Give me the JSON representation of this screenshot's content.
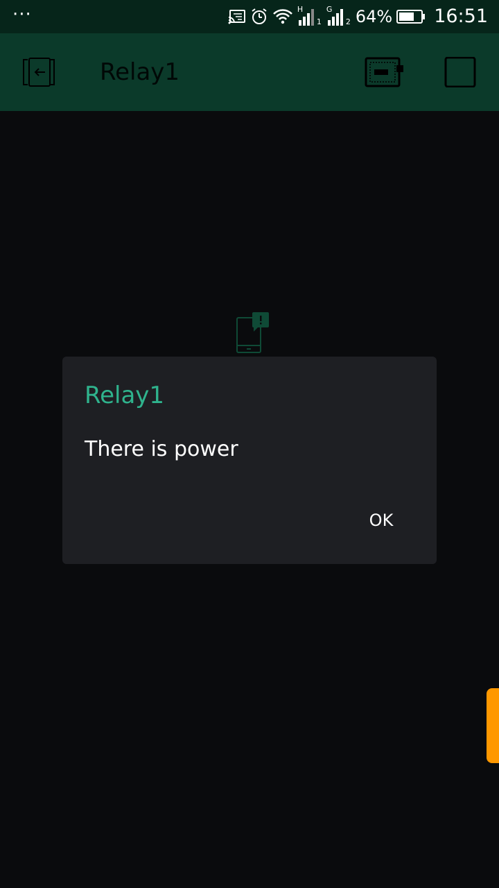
{
  "status_bar": {
    "dots": "···",
    "battery": "64%",
    "time": "16:51",
    "signal1_label": "H",
    "signal1_sub": "1",
    "signal2_label": "G",
    "signal2_sub": "2",
    "icons": [
      "cast-icon",
      "alarm-icon",
      "wifi-icon",
      "signal-icon",
      "signal-icon",
      "battery-icon"
    ]
  },
  "toolbar": {
    "title": "Relay1",
    "icons": [
      "exit-icon",
      "device-icon",
      "stop-icon"
    ]
  },
  "dialog": {
    "title": "Relay1",
    "message": "There is power",
    "ok_label": "OK"
  },
  "colors": {
    "status_bar_bg": "#06251a",
    "toolbar_bg": "#0b3a2a",
    "screen_bg": "#0a0b0d",
    "dialog_bg": "#1e1f23",
    "dialog_title": "#2fb38d",
    "side_tab": "#ff9800"
  }
}
